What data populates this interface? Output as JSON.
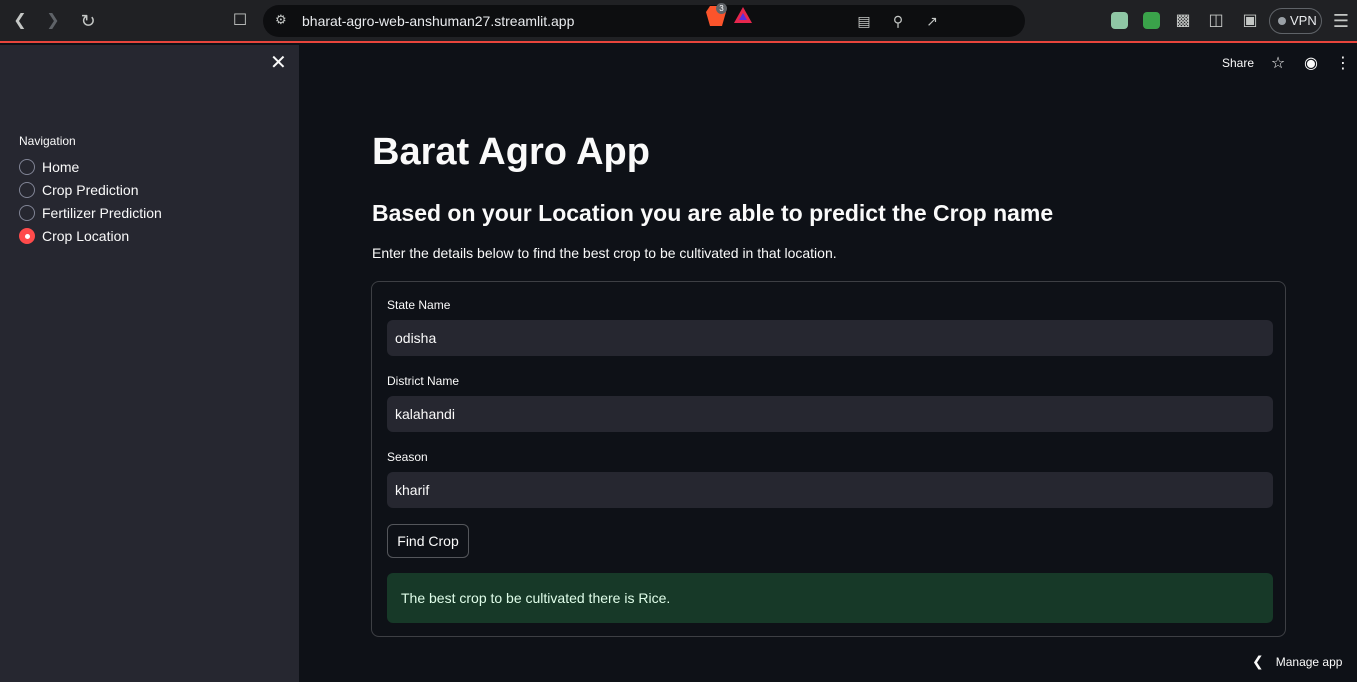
{
  "browser": {
    "url": "bharat-agro-web-anshuman27.streamlit.app",
    "vpn_label": "VPN",
    "brave_count": "3"
  },
  "sidebar": {
    "nav_label": "Navigation",
    "items": [
      {
        "label": "Home",
        "selected": false
      },
      {
        "label": "Crop Prediction",
        "selected": false
      },
      {
        "label": "Fertilizer Prediction",
        "selected": false
      },
      {
        "label": "Crop Location",
        "selected": true
      }
    ]
  },
  "header": {
    "share_label": "Share"
  },
  "main": {
    "title": "Barat Agro App",
    "subtitle": "Based on your Location you are able to predict the Crop name",
    "description": "Enter the details below to find the best crop to be cultivated in that location.",
    "fields": [
      {
        "label": "State Name",
        "value": "odisha"
      },
      {
        "label": "District Name",
        "value": "kalahandi"
      },
      {
        "label": "Season",
        "value": "kharif"
      }
    ],
    "button_label": "Find Crop",
    "result": "The best crop to be cultivated there is Rice."
  },
  "footer": {
    "manage_label": "Manage app"
  }
}
